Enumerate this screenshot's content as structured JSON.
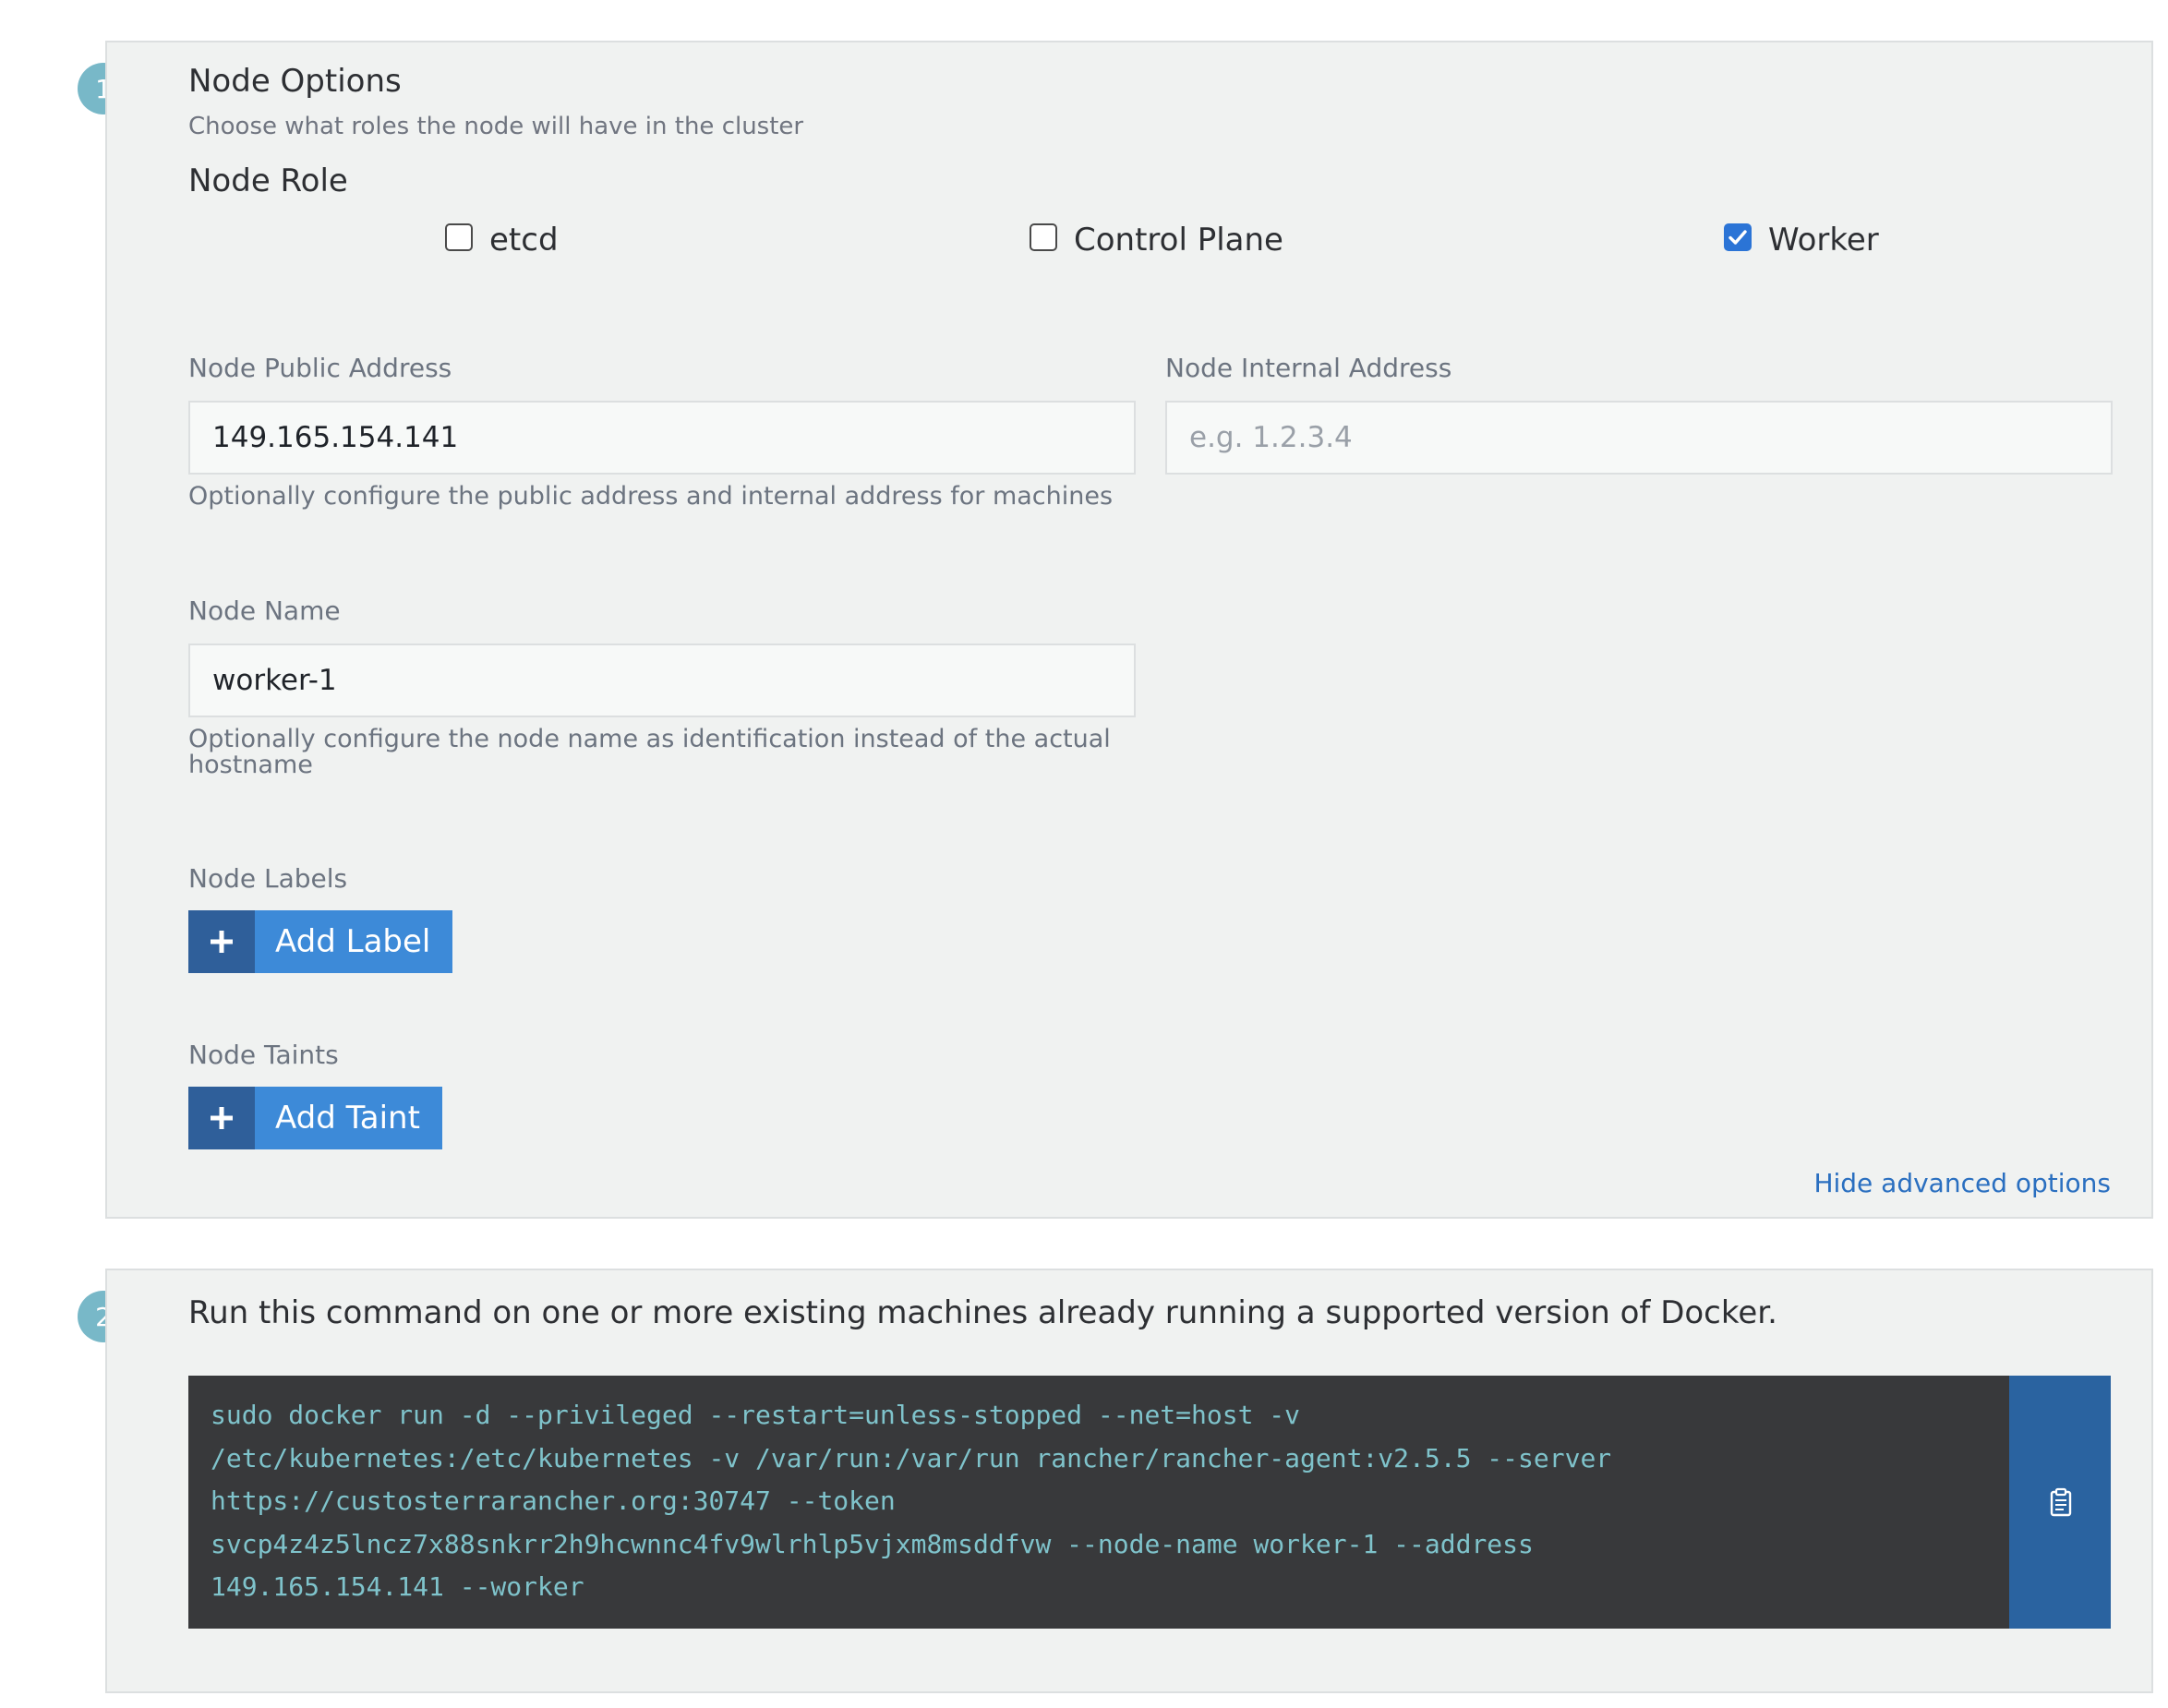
{
  "step1": {
    "number": "1",
    "title": "Node Options",
    "subtitle": "Choose what roles the node will have in the cluster",
    "node_role_heading": "Node Role",
    "roles": [
      {
        "label": "etcd",
        "checked": false
      },
      {
        "label": "Control Plane",
        "checked": false
      },
      {
        "label": "Worker",
        "checked": true
      }
    ],
    "public_address": {
      "label": "Node Public Address",
      "value": "149.165.154.141",
      "placeholder": ""
    },
    "internal_address": {
      "label": "Node Internal Address",
      "value": "",
      "placeholder": "e.g. 1.2.3.4"
    },
    "address_help": "Optionally configure the public address and internal address for machines",
    "node_name": {
      "label": "Node Name",
      "value": "worker-1",
      "help": "Optionally configure the node name as identification instead of the actual hostname"
    },
    "labels": {
      "label": "Node Labels",
      "button": "Add Label"
    },
    "taints": {
      "label": "Node Taints",
      "button": "Add Taint"
    },
    "hide_advanced_link": "Hide advanced options"
  },
  "step2": {
    "number": "2",
    "instruction": "Run this command on one or more existing machines already running a supported version of Docker.",
    "command_lines": [
      "sudo docker run -d --privileged --restart=unless-stopped --net=host -v",
      "/etc/kubernetes:/etc/kubernetes -v /var/run:/var/run rancher/rancher-agent:v2.5.5 --server",
      "https://custosterrarancher.org:30747 --token",
      "svcp4z4z5lncz7x88snkrr2h9hcwnnc4fv9wlrhlp5vjxm8msddfvw --node-name worker-1 --address",
      "149.165.154.141 --worker"
    ]
  },
  "icons": {
    "checkmark": "checkmark-icon",
    "plus": "plus-icon",
    "copy": "clipboard-icon"
  },
  "colors": {
    "accent_blue": "#3d8ad8",
    "dark_blue": "#2f5f9a",
    "badge_teal": "#78b8c8",
    "code_bg": "#38393b",
    "code_text": "#7fc3cb",
    "checkbox_checked": "#2b74d6"
  }
}
